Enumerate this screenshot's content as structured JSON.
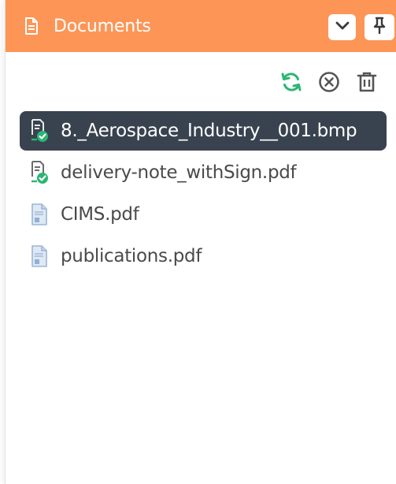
{
  "panel": {
    "title": "Documents",
    "header_icon": "document-icon",
    "collapse_icon": "chevron-down-icon",
    "pin_icon": "pin-icon",
    "accent_color": "#fd9556"
  },
  "toolbar": {
    "refresh_icon": "refresh-icon",
    "close_icon": "close-circle-icon",
    "delete_icon": "trash-icon",
    "refresh_color": "#2bb673"
  },
  "files": [
    {
      "name": "8._Aerospace_Industry__001.bmp",
      "icon": "signed-document-icon",
      "selected": true
    },
    {
      "name": "delivery-note_withSign.pdf",
      "icon": "signed-document-icon",
      "selected": false
    },
    {
      "name": "CIMS.pdf",
      "icon": "file-icon",
      "selected": false
    },
    {
      "name": "publications.pdf",
      "icon": "file-icon",
      "selected": false
    }
  ],
  "selected_color": "#39434f"
}
